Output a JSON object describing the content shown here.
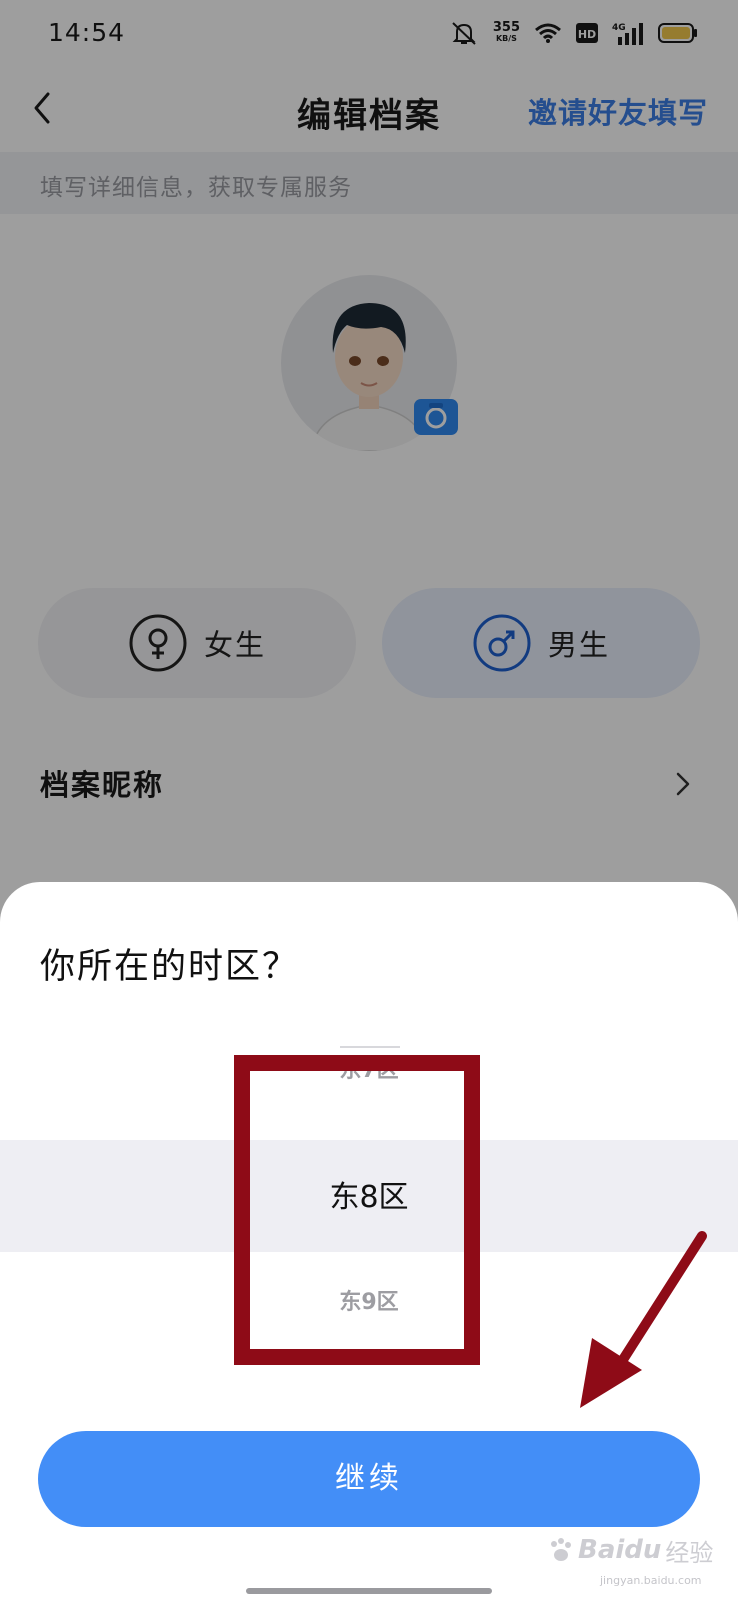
{
  "status_bar": {
    "time": "14:54",
    "network_speed": "355",
    "network_unit": "KB/S",
    "icons": [
      "mute-icon",
      "wifi-icon",
      "hd-icon",
      "signal-4g-icon",
      "battery-icon"
    ]
  },
  "header": {
    "title": "编辑档案",
    "invite_link": "邀请好友填写",
    "back_icon": "chevron-left-icon"
  },
  "subtitle": "填写详细信息，获取专属服务",
  "gender": {
    "female_label": "女生",
    "male_label": "男生",
    "selected": "male"
  },
  "nickname": {
    "label": "档案昵称"
  },
  "sheet": {
    "title": "你所在的时区？",
    "picker": {
      "prev": "东7区",
      "selected": "东8区",
      "next": "东9区"
    },
    "continue_label": "继续"
  },
  "watermark": {
    "brand": "Baidu",
    "suffix": "经验",
    "url": "jingyan.baidu.com"
  },
  "colors": {
    "accent": "#438ef7",
    "link": "#3d7fe6",
    "annotation": "#8e0b17"
  }
}
